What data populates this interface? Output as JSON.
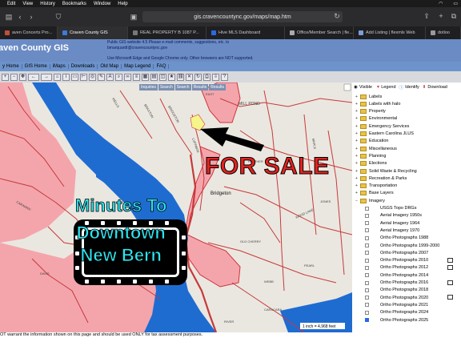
{
  "mac_menu": {
    "items": [
      "Edit",
      "View",
      "History",
      "Bookmarks",
      "Window",
      "Help"
    ]
  },
  "browser": {
    "url": "gis.cravencountync.gov/maps/map.htm",
    "tabs": [
      {
        "label": "aven Concerts Pro...",
        "active": false,
        "color": "#c24f3a"
      },
      {
        "label": "Craven County GIS",
        "active": true,
        "color": "#3d7bd6"
      },
      {
        "label": "REAL PROPERTY B 1087 P...",
        "active": false,
        "color": "#777777"
      },
      {
        "label": "Hive MLS Dashboard",
        "active": false,
        "color": "#2a6ae0"
      },
      {
        "label": "Office/Member Search | fle...",
        "active": false,
        "color": "#aaaaaa"
      },
      {
        "label": "Add Listing | flexmls Web",
        "active": false,
        "color": "#7a9fd6"
      },
      {
        "label": "dotloo",
        "active": false,
        "color": "#999999"
      }
    ]
  },
  "gis": {
    "title": "aven County GIS",
    "notes": [
      "Public GIS website 4.5 Please e-mail comments, suggestions, etc. to",
      "bmarquardt@cravencountync.gov",
      "",
      "Use Microsoft Edge and Google Chrome only. Other browsers are NOT supported."
    ],
    "menu": [
      "y Home",
      "GIS Home",
      "iMaps",
      "Downloads",
      "Old Map",
      "Map Legend",
      "FAQ"
    ],
    "overlay_buttons": [
      "Inquiries",
      "Search",
      "Search",
      "Results",
      "Results"
    ],
    "panel": {
      "visible": "Visible",
      "legend": "Legend",
      "identify": "Identify",
      "download": "Download"
    },
    "layers": [
      {
        "label": "Labels",
        "type": "folder"
      },
      {
        "label": "Labels with halo",
        "type": "folder"
      },
      {
        "label": "Property",
        "type": "folder"
      },
      {
        "label": "Environmental",
        "type": "folder"
      },
      {
        "label": "Emergency Services",
        "type": "folder"
      },
      {
        "label": "Eastern Carolina JLUS",
        "type": "folder"
      },
      {
        "label": "Education",
        "type": "folder"
      },
      {
        "label": "Miscellaneous",
        "type": "folder"
      },
      {
        "label": "Planning",
        "type": "folder"
      },
      {
        "label": "Elections",
        "type": "folder"
      },
      {
        "label": "Solid Waste & Recycling",
        "type": "folder"
      },
      {
        "label": "Recreation & Parks",
        "type": "folder"
      },
      {
        "label": "Transportation",
        "type": "folder"
      },
      {
        "label": "Base Layers",
        "type": "folder"
      },
      {
        "label": "Imagery",
        "type": "folder"
      },
      {
        "label": "USGS Topo DRGs",
        "type": "layer",
        "checked": false
      },
      {
        "label": "Aerial Imagery 1950s",
        "type": "layer",
        "checked": false
      },
      {
        "label": "Aerial Imagery 1964",
        "type": "layer",
        "checked": false
      },
      {
        "label": "Aerial Imagery 1970",
        "type": "layer",
        "checked": false
      },
      {
        "label": "Ortho Photographs 1988",
        "type": "layer",
        "checked": false
      },
      {
        "label": "Ortho Photographs 1999-2000",
        "type": "layer",
        "checked": false
      },
      {
        "label": "Ortho Photographs 2007",
        "type": "layer",
        "checked": false
      },
      {
        "label": "Ortho Photographs 2010",
        "type": "layer",
        "checked": false,
        "info": true
      },
      {
        "label": "Ortho Photographs 2012",
        "type": "layer",
        "checked": false,
        "info": true
      },
      {
        "label": "Ortho Photographs 2014",
        "type": "layer",
        "checked": false
      },
      {
        "label": "Ortho Photographs 2016",
        "type": "layer",
        "checked": false,
        "info": true
      },
      {
        "label": "Ortho Photographs 2018",
        "type": "layer",
        "checked": false
      },
      {
        "label": "Ortho Photographs 2020",
        "type": "layer",
        "checked": false,
        "info": true
      },
      {
        "label": "Ortho Photographs 2021",
        "type": "layer",
        "checked": false
      },
      {
        "label": "Ortho Photographs 2024",
        "type": "layer",
        "checked": false
      },
      {
        "label": "Ortho Photographs 2025",
        "type": "layer",
        "checked": true
      }
    ],
    "scale": "1 inch = 4,968 feet",
    "footer": "OT warrant the information shown on this page and should be used ONLY for tax assessment purposes."
  },
  "map_labels": {
    "bridgeton": "Bridgeton",
    "mill_pond": "MILL POND",
    "street_labels": [
      "BRAXTON",
      "BRIDGETON",
      "WELLS",
      "LUFFMAN",
      "HEATHER",
      "MAPLE",
      "WOOD LAKE",
      "OLD CHERRY",
      "WEBB",
      "CARAWAN",
      "DAVIS",
      "PEARL",
      "JONES",
      "CARACARA",
      "RIVER",
      "EAST"
    ]
  },
  "annotations": {
    "for_sale": "FOR SALE",
    "callout_line1": "Minutes To",
    "callout_line2": "Downtown",
    "callout_line3": "New Bern"
  },
  "colors": {
    "header": "#6b8bc4",
    "pink_area": "#f4a5ac",
    "water": "#1f6cd1",
    "roads": "#c63a3a",
    "for_sale": "#e3231f",
    "callout": "#2de4ef"
  }
}
